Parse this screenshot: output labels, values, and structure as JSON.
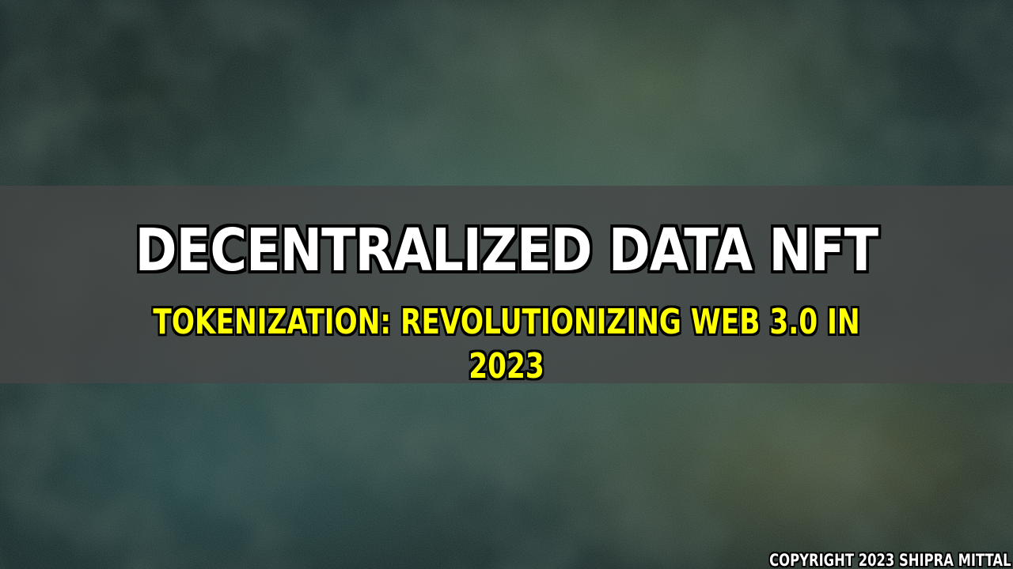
{
  "banner": {
    "title": "DECENTRALIZED DATA NFT",
    "subtitle": "TOKENIZATION: REVOLUTIONIZING WEB 3.0 IN 2023"
  },
  "footer": {
    "copyright": "COPYRIGHT 2023 SHIPRA MITTAL"
  },
  "colors": {
    "title": "#ffffff",
    "subtitle": "#ffff00",
    "banner": "#464646",
    "background": "#3b5a52"
  }
}
